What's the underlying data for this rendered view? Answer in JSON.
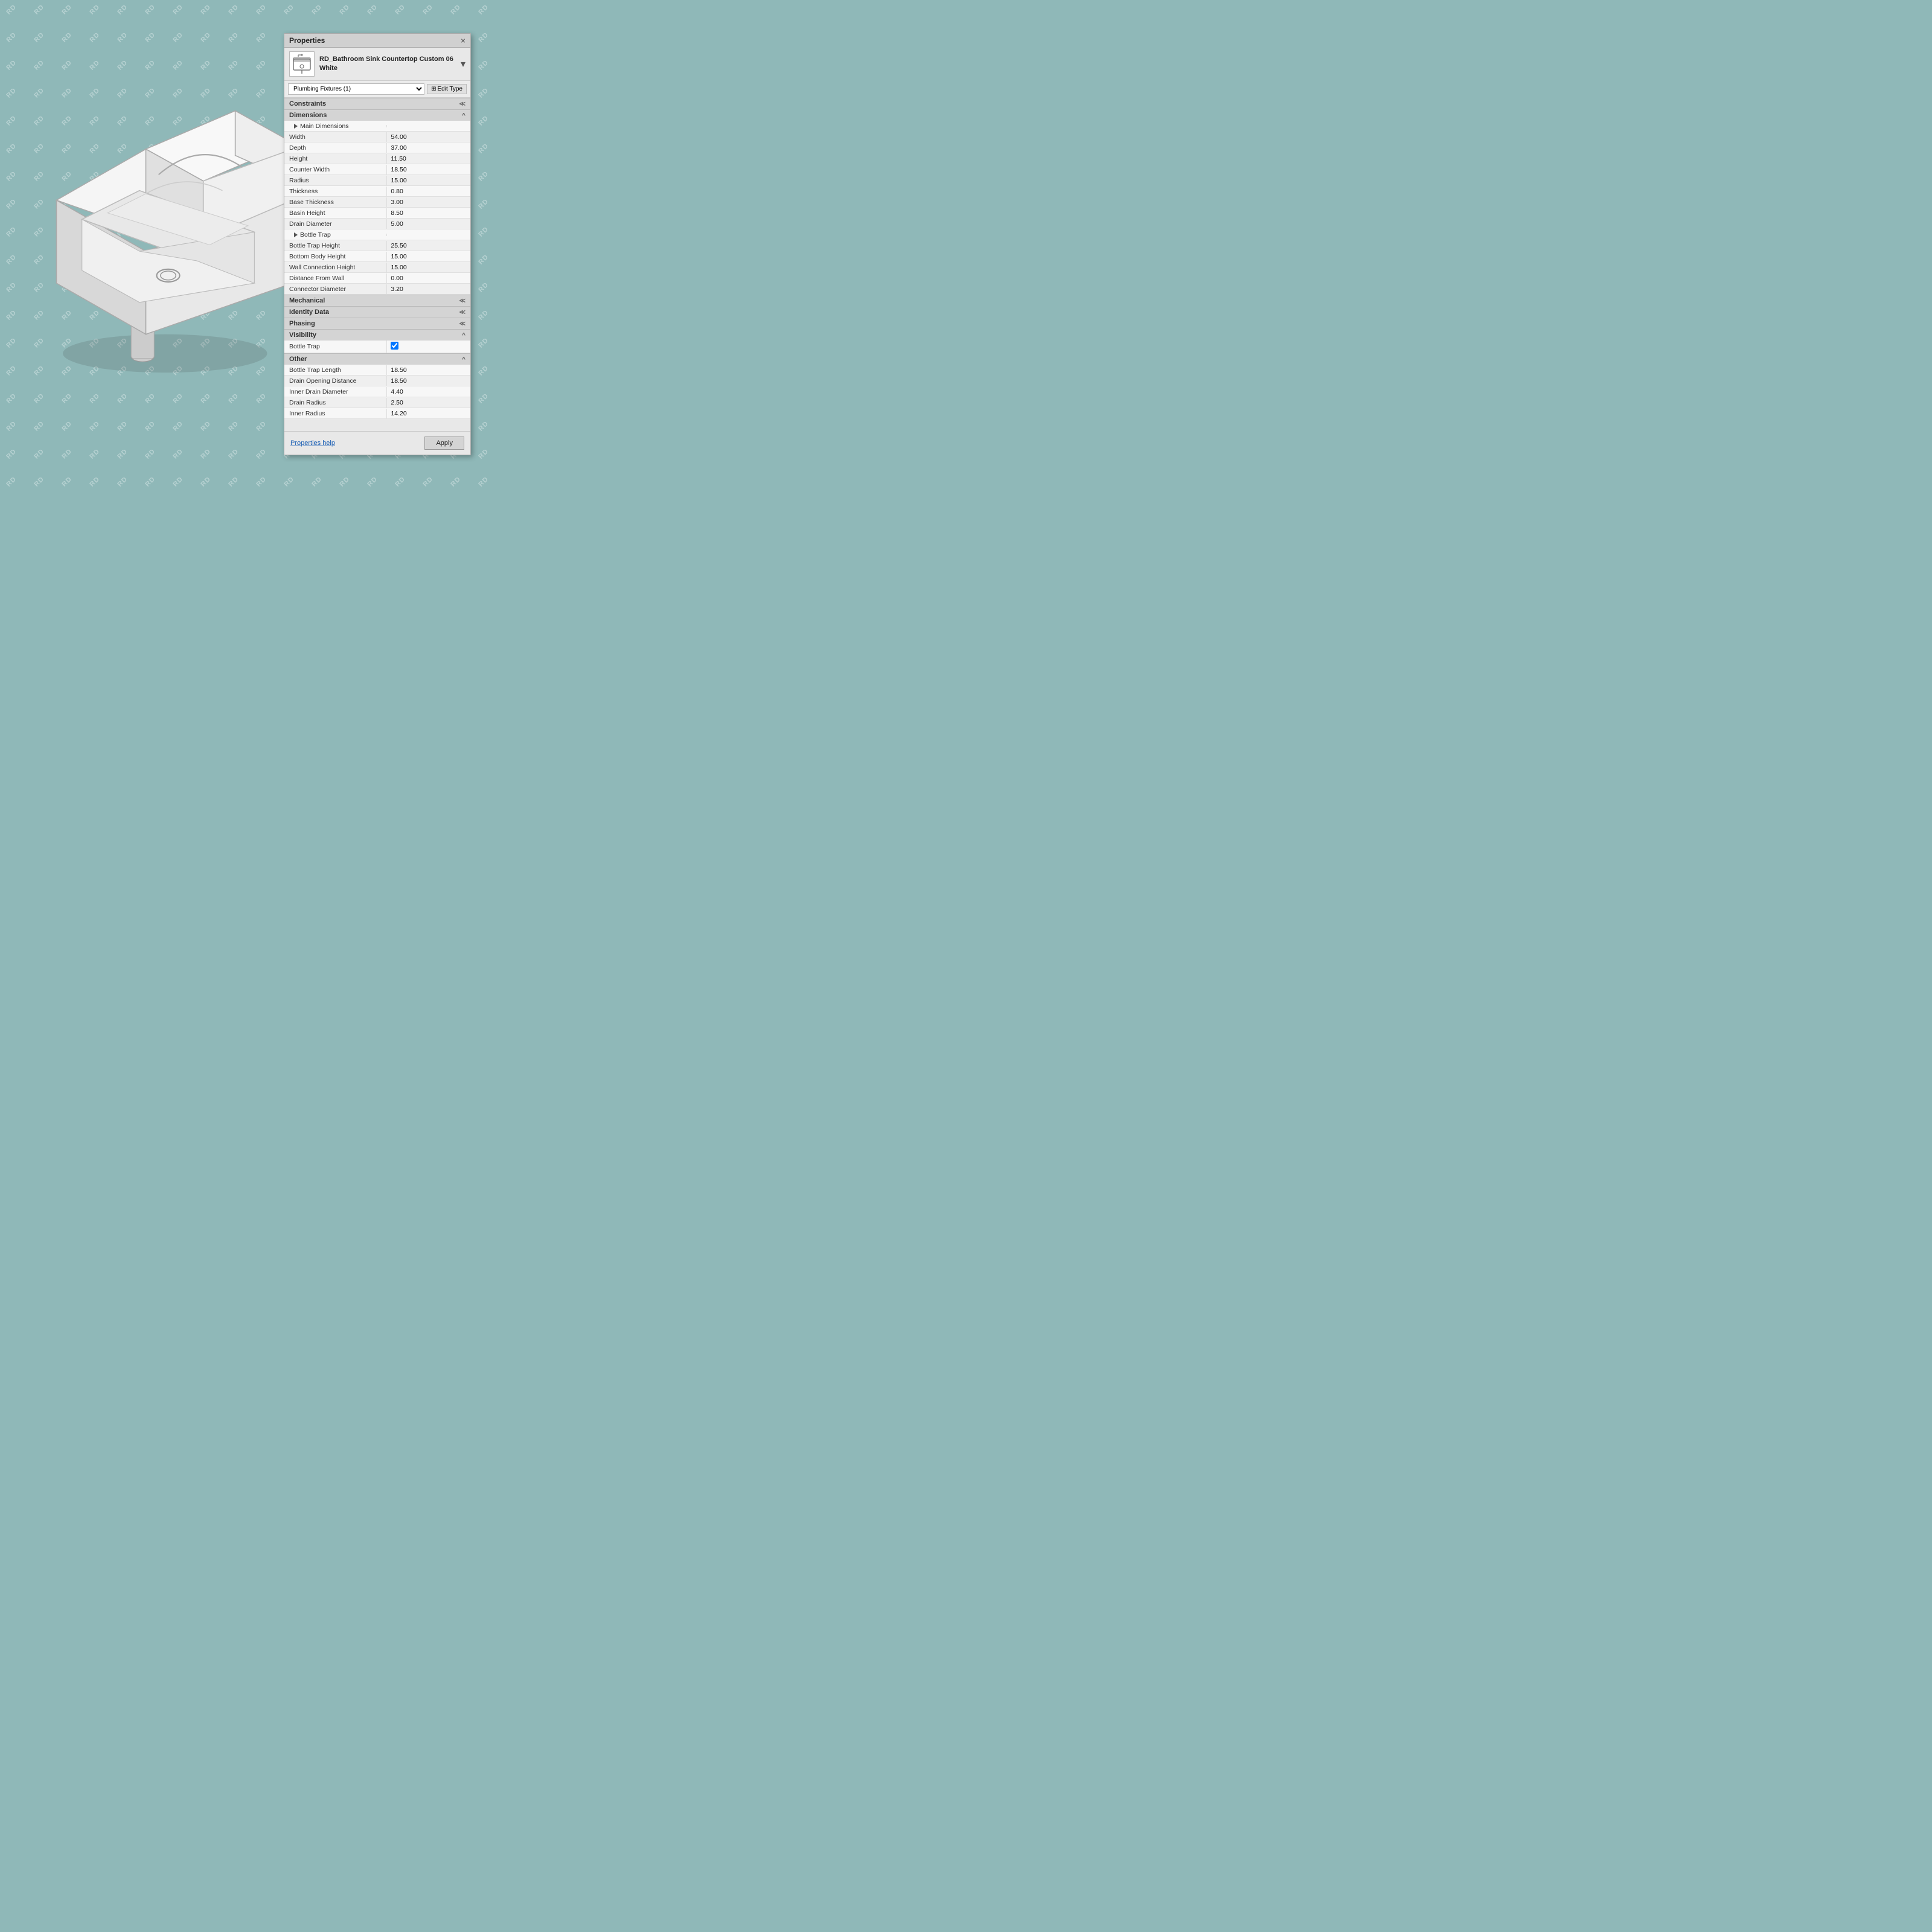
{
  "watermark": {
    "text": "RD"
  },
  "panel": {
    "title": "Properties",
    "close_label": "×",
    "header": {
      "name_line1": "RD_Bathroom Sink Countertop Custom 06",
      "name_line2": "White"
    },
    "dropdown": {
      "label": "Plumbing Fixtures (1)",
      "options": [
        "Plumbing Fixtures (1)"
      ]
    },
    "edit_type_label": "Edit Type",
    "sections": {
      "constraints": {
        "label": "Constraints",
        "collapse_symbol": "≪"
      },
      "dimensions": {
        "label": "Dimensions",
        "collapse_symbol": "^"
      },
      "mechanical": {
        "label": "Mechanical",
        "collapse_symbol": "≪"
      },
      "identity_data": {
        "label": "Identity Data",
        "collapse_symbol": "≪"
      },
      "phasing": {
        "label": "Phasing",
        "collapse_symbol": "≪"
      },
      "visibility": {
        "label": "Visibility",
        "collapse_symbol": "^"
      },
      "other": {
        "label": "Other",
        "collapse_symbol": "^"
      }
    },
    "properties": [
      {
        "label": "Main Dimensions",
        "value": "",
        "type": "group"
      },
      {
        "label": "Width",
        "value": "54.00"
      },
      {
        "label": "Depth",
        "value": "37.00"
      },
      {
        "label": "Height",
        "value": "11.50"
      },
      {
        "label": "Counter Width",
        "value": "18.50"
      },
      {
        "label": "Radius",
        "value": "15.00"
      },
      {
        "label": "Thickness",
        "value": "0.80"
      },
      {
        "label": "Base Thickness",
        "value": "3.00"
      },
      {
        "label": "Basin Height",
        "value": "8.50"
      },
      {
        "label": "Drain Diameter",
        "value": "5.00"
      },
      {
        "label": "Bottle Trap",
        "value": "",
        "type": "group"
      },
      {
        "label": "Bottle Trap Height",
        "value": "25.50"
      },
      {
        "label": "Bottom Body Height",
        "value": "15.00"
      },
      {
        "label": "Wall Connection Height",
        "value": "15.00"
      },
      {
        "label": "Distance From Wall",
        "value": "0.00"
      },
      {
        "label": "Connector Diameter",
        "value": "3.20"
      }
    ],
    "other_properties": [
      {
        "label": "Bottle Trap Length",
        "value": "18.50"
      },
      {
        "label": "Drain Opening Distance",
        "value": "18.50"
      },
      {
        "label": "Inner Drain Diameter",
        "value": "4.40"
      },
      {
        "label": "Drain Radius",
        "value": "2.50"
      },
      {
        "label": "Inner Radius",
        "value": "14.20"
      }
    ],
    "visibility_items": [
      {
        "label": "Bottle Trap",
        "checked": true
      }
    ],
    "footer": {
      "help_text": "Properties help",
      "apply_label": "Apply"
    }
  }
}
